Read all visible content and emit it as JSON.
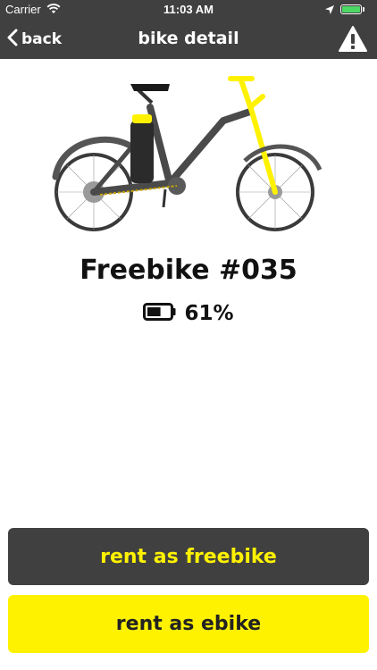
{
  "status_bar": {
    "carrier": "Carrier",
    "time": "11:03 AM",
    "icons": [
      "wifi-icon",
      "location-arrow-icon",
      "battery-icon"
    ],
    "battery_color": "#4cd964"
  },
  "nav_bar": {
    "back_label": "back",
    "title": "bike detail",
    "warning_icon": "warning-icon",
    "background_color": "#404040"
  },
  "bike": {
    "image": "bike-illustration",
    "name": "Freebike #035",
    "battery_icon": "battery-icon",
    "battery_percent": "61%",
    "battery_level": 0.61,
    "accent_color": "#fff200"
  },
  "actions": {
    "rent_freebike_label": "rent as freebike",
    "rent_ebike_label": "rent as ebike"
  }
}
